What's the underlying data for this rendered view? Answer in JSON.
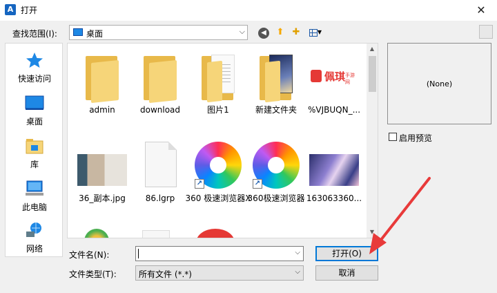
{
  "window": {
    "title": "打开",
    "app_icon_letter": "A",
    "close_glyph": "✕"
  },
  "lookin": {
    "label": "查找范围(I):",
    "value": "桌面"
  },
  "places": [
    {
      "label": "快速访问",
      "icon": "star-icon"
    },
    {
      "label": "桌面",
      "icon": "desktop-icon"
    },
    {
      "label": "库",
      "icon": "library-icon"
    },
    {
      "label": "此电脑",
      "icon": "computer-icon"
    },
    {
      "label": "网络",
      "icon": "network-icon"
    }
  ],
  "files": [
    {
      "name": "admin",
      "kind": "folder"
    },
    {
      "name": "download",
      "kind": "folder"
    },
    {
      "name": "图片1",
      "kind": "folder-doc"
    },
    {
      "name": "新建文件夹",
      "kind": "folder-photo"
    },
    {
      "name": "%VJBUQN_...",
      "kind": "logo",
      "logo_text": "佩琪",
      "logo_sub": "手游网"
    },
    {
      "name": "36_副本.jpg",
      "kind": "photo"
    },
    {
      "name": "86.lgrp",
      "kind": "blank"
    },
    {
      "name": "360 极速浏览器X",
      "kind": "swirl-shortcut"
    },
    {
      "name": "360极速浏览器",
      "kind": "swirl-shortcut"
    },
    {
      "name": "163063360...",
      "kind": "anime"
    }
  ],
  "preview": {
    "none_text": "(None)",
    "checkbox_label": "启用预览",
    "checked": false
  },
  "form": {
    "filename_label": "文件名(N):",
    "filename_value": "",
    "filetype_label": "文件类型(T):",
    "filetype_value": "所有文件 (*.*)",
    "open_label": "打开(O)",
    "cancel_label": "取消"
  },
  "colors": {
    "accent": "#0078d7",
    "annotation_arrow": "#e83a3a",
    "folder": "#f6d579"
  }
}
